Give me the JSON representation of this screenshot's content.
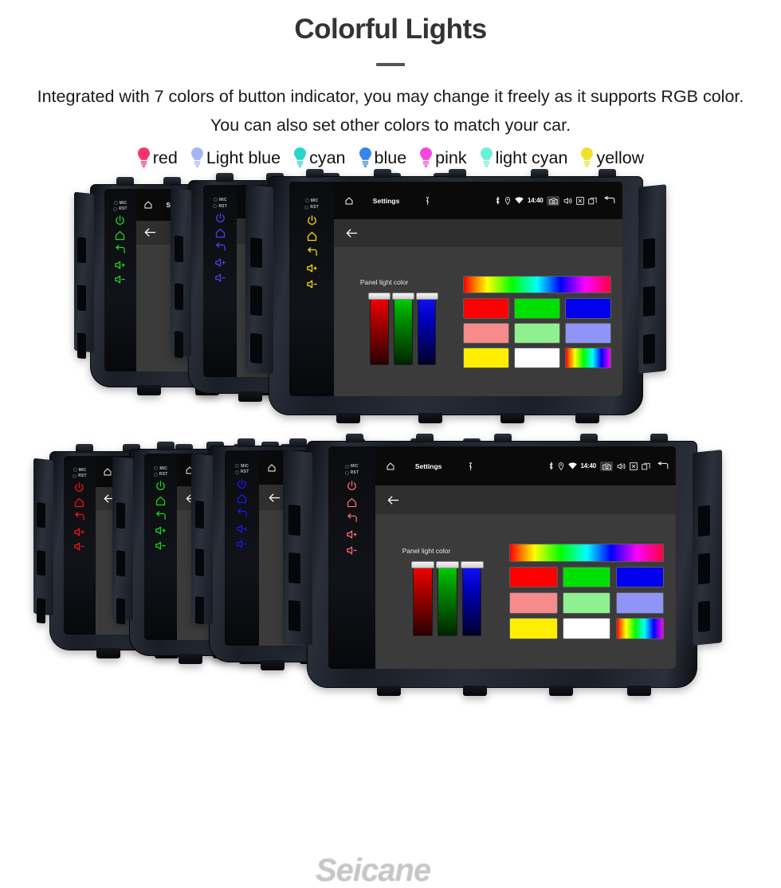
{
  "header": {
    "title": "Colorful Lights",
    "subtitle": "Integrated with 7 colors of button indicator, you may change it freely as it supports RGB color. You can also set other colors to match your car."
  },
  "legend": {
    "items": [
      {
        "label": "red",
        "color": "#f6346c"
      },
      {
        "label": "Light blue",
        "color": "#a6b6f5"
      },
      {
        "label": "cyan",
        "color": "#2ad6c8"
      },
      {
        "label": "blue",
        "color": "#3a86e8"
      },
      {
        "label": "pink",
        "color": "#f649e0"
      },
      {
        "label": "light cyan",
        "color": "#6df0d8"
      },
      {
        "label": "yellow",
        "color": "#ede22f"
      }
    ]
  },
  "device": {
    "status_bar": {
      "home_icon": "home-icon",
      "title": "Settings",
      "usb_icon": "usb-icon",
      "bluetooth_icon": "bluetooth-icon",
      "location_icon": "location-icon",
      "wifi_icon": "wifi-icon",
      "time": "14:40",
      "camera_icon": "camera-icon",
      "volume_icon": "volume-icon",
      "close_icon": "close-box-icon",
      "recents_icon": "recent-apps-icon",
      "back_icon": "back-arrow-icon"
    },
    "app_bar": {
      "back_icon": "back-arrow-icon"
    },
    "dialog": {
      "label": "Panel light color",
      "sliders": [
        {
          "name": "red-slider",
          "color": "#ff0000"
        },
        {
          "name": "green-slider",
          "color": "#00d900"
        },
        {
          "name": "blue-slider",
          "color": "#1414ff"
        }
      ],
      "rainbow_bar": "rainbow-gradient",
      "swatch_rows": [
        [
          "#ff0000",
          "#00e000",
          "#0000ee"
        ],
        [
          "#f78a8a",
          "#8ff08f",
          "#8f95f7"
        ],
        [
          "#ffee00",
          "#ffffff",
          "gradient"
        ]
      ]
    },
    "side_buttons": {
      "mic_label": "MIC",
      "rst_label": "RST",
      "icons": [
        "power-icon",
        "home-icon",
        "back-icon",
        "volume-up-icon",
        "volume-down-icon"
      ]
    }
  },
  "units": {
    "top_row": [
      {
        "name": "unit-top-green",
        "indicator_color": "#23d123"
      },
      {
        "name": "unit-top-blue",
        "indicator_color": "#4a40e6"
      },
      {
        "name": "unit-top-yellow",
        "indicator_color": "#f2d90a"
      }
    ],
    "bottom_row": [
      {
        "name": "unit-bottom-red",
        "indicator_color": "#ee1111"
      },
      {
        "name": "unit-bottom-green",
        "indicator_color": "#16d616"
      },
      {
        "name": "unit-bottom-blue",
        "indicator_color": "#1818ec"
      },
      {
        "name": "unit-bottom-pink",
        "indicator_color": "#f26c6c"
      }
    ]
  },
  "watermark": {
    "text": "Seicane"
  }
}
